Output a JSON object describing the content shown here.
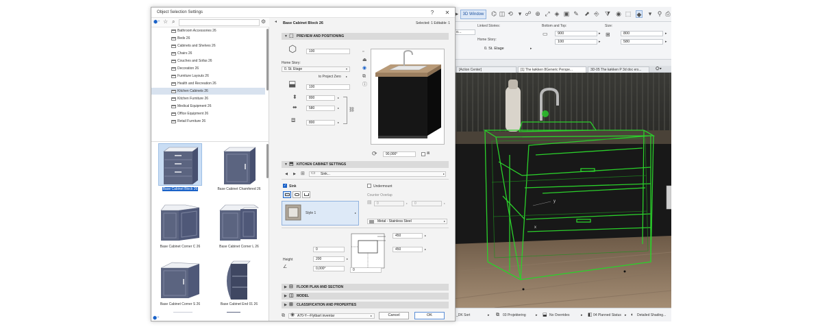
{
  "app": {
    "ribbon": {
      "window_3d": "3D Window"
    },
    "infobox": {
      "linked_stories_label": "Linked Stories:",
      "home_story_label": "Home Story:",
      "home_story_value": "0. St. Etage",
      "bottom_top_label": "Bottom and Top:",
      "bottom_value": "900",
      "top_value": "100",
      "size_label": "Size:",
      "size_a": "800",
      "size_b": "580",
      "left_value": "o..."
    },
    "tabs": [
      "[Action Center]",
      "[1] The køkken 8Generic Perspe...",
      "3D-05 The køkken P 3d doc ers..."
    ],
    "status": [
      "_DK Sort",
      "03 Projektering",
      "No Overrides",
      "04 Planned Status",
      "Detailed Shading..."
    ],
    "axis_y": "y",
    "axis_x": "x"
  },
  "dialog": {
    "title": "Object Selection Settings",
    "help": "?",
    "close": "✕",
    "library": {
      "folders": [
        "Bathroom Accessories 26",
        "Beds 26",
        "Cabinets and Shelves 26",
        "Chairs 26",
        "Couches and Sofas 26",
        "Decoration 26",
        "Furniture Layouts 26",
        "Health and Recreation 26",
        "Kitchen Cabinets 26",
        "Kitchen Furniture 26",
        "Medical Equipment 26",
        "Office Equipment 26",
        "Retail Furniture 26"
      ],
      "selected_folder": "Kitchen Cabinets 26",
      "items": [
        "Base Cabinet Block 26",
        "Base Cabinet Chamfered 26",
        "Base Cabinet Corner C 26",
        "Base Cabinet Corner L 26",
        "Base Cabinet Corner S 26",
        "Base Cabinet End 01 26"
      ],
      "selected_item": "Base Cabinet Block 26"
    },
    "settings": {
      "object_title": "Base Cabinet Block 26",
      "selected_info": "Selected: 1 Editable: 1",
      "section_preview": "PREVIEW AND POSITIONING",
      "height_value": "100",
      "home_story_label": "Home Story:",
      "home_story_value": "0. St. Etage",
      "to_project_zero": "to Project Zero",
      "offset_value": "100",
      "width_value": "800",
      "depth_value": "580",
      "size_c": "800",
      "rotation_value": "90,000°",
      "section_kitchen": "KITCHEN CABINET SETTINGS",
      "nav_value": "Sink...",
      "sink_label": "Sink",
      "undermount_label": "Undermount",
      "counter_overlap_label": "Counter Overlap",
      "overlap_a": "0",
      "overlap_b": "0",
      "style_label": "Style 1",
      "material_label": "Metal - Stainless Steel",
      "dim_a": "450",
      "dim_b": "450",
      "dim_zero_a": "0",
      "dim_zero_b": "0",
      "height_label": "Height",
      "height_field": "200",
      "angle_value": "0,000°",
      "section_floor": "FLOOR PLAN AND SECTION",
      "section_model": "MODEL",
      "section_class": "CLASSIFICATION AND PROPERTIES",
      "layer_value": "A70-Y---Flytbart inventar",
      "cancel": "Cancel",
      "ok": "OK"
    }
  },
  "colors": {
    "accent": "#1a62c8",
    "selection_green": "#2bd12b",
    "cabinet_fill": "#5b6480",
    "dark_cabinet": "#151515"
  }
}
